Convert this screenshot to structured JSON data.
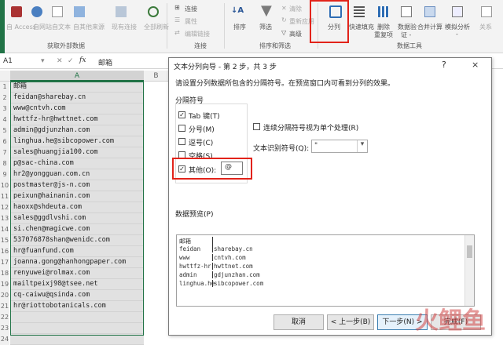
{
  "ribbon": {
    "access": "自 Access",
    "web": "自网站",
    "text": "自文本",
    "other": "自其他来源",
    "existing": "现有连接",
    "refresh": "全部刷新",
    "connections": "连接",
    "properties": "属性",
    "edit_links": "编辑链接",
    "sort": "排序",
    "filter": "筛选",
    "clear": "清除",
    "reapply": "重新应用",
    "advanced": "高级",
    "text_to_columns": "分列",
    "flash_fill": "快速填充",
    "remove_dup_1": "删除",
    "remove_dup_2": "重复项",
    "validation_1": "数据验",
    "validation_2": "证 -",
    "consolidate": "合并计算",
    "whatif_1": "模拟分析",
    "whatif_2": "-",
    "relations": "关系",
    "group_get_external": "获取外部数据",
    "group_connections": "连接",
    "group_sort_filter": "排序和筛选",
    "group_data_tools": "数据工具"
  },
  "formula_bar": {
    "name_box": "A1",
    "fx": "fx",
    "value": "邮箱"
  },
  "grid": {
    "columns": [
      "A",
      "B"
    ],
    "rows": [
      "1",
      "2",
      "3",
      "4",
      "5",
      "6",
      "7",
      "8",
      "9",
      "10",
      "11",
      "12",
      "13",
      "14",
      "15",
      "16",
      "17",
      "18",
      "19",
      "20",
      "21",
      "22",
      "23",
      "24"
    ],
    "cells": [
      "邮箱",
      "feidan@sharebay.cn",
      "www@cntvh.com",
      "hwttfz-hr@hwttnet.com",
      "admin@gdjunzhan.com",
      "linghua.he@sibcopower.com",
      "sales@huangjia100.com",
      "p@sac-china.com",
      "hr2@yongguan.com.cn",
      "postmaster@js-n.com",
      "peixun@hainanin.com",
      "haoxx@shdeuta.com",
      "sales@ggdlvshi.com",
      "si.chen@magicwe.com",
      "537076878shan@wenidc.com",
      "hr@fuanfund.com",
      "joanna.gong@hanhongpaper.com",
      "renyuwei@rolmax.com",
      "mailtpeixj98@tsee.net",
      "cq-caiwu@qsinda.com",
      "hr@riottobotanicals.com",
      "",
      "",
      ""
    ]
  },
  "dialog": {
    "title": "文本分列向导 - 第 2 步，共 3 步",
    "help": "?",
    "close": "×",
    "instruction": "请设置分列数据所包含的分隔符号。在预览窗口内可看到分列的效果。",
    "delim_group": "分隔符号",
    "tab": "Tab 键(T)",
    "semicolon": "分号(M)",
    "comma": "逗号(C)",
    "space": "空格(S)",
    "other": "其他(O):",
    "other_value": "@",
    "consecutive": "连续分隔符号视为单个处理(R)",
    "qualifier_label": "文本识别符号(Q):",
    "qualifier_value": "\"",
    "preview_label": "数据预览(P)",
    "preview": [
      [
        "邮箱",
        ""
      ],
      [
        "feidan",
        "sharebay.cn"
      ],
      [
        "www",
        "cntvh.com"
      ],
      [
        "hwttfz-hr",
        "hwttnet.com"
      ],
      [
        "admin",
        "gdjunzhan.com"
      ],
      [
        "linghua.he",
        "sibcopower.com"
      ]
    ],
    "cancel": "取消",
    "back": "< 上一步(B)",
    "next": "下一步(N) >",
    "finish": "完成(F)"
  },
  "watermark": "火鲤鱼",
  "colors": {
    "selection": "#e1e1e1",
    "highlight": "#e2231a",
    "excel_green": "#217346"
  }
}
